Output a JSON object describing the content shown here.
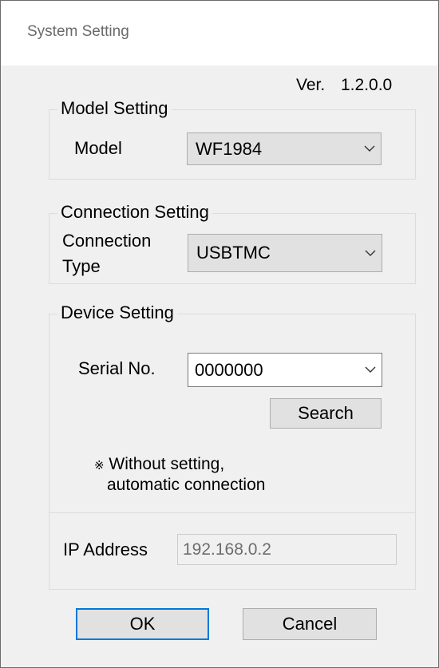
{
  "window": {
    "title": "System Setting"
  },
  "version": {
    "label": "Ver.",
    "value": "1.2.0.0"
  },
  "model_setting": {
    "legend": "Model Setting",
    "model_label": "Model",
    "model_value": "WF1984"
  },
  "connection_setting": {
    "legend": "Connection Setting",
    "type_label_line1": "Connection",
    "type_label_line2": "Type",
    "type_value": "USBTMC"
  },
  "device_setting": {
    "legend": "Device Setting",
    "serial_label": "Serial No.",
    "serial_value": "0000000",
    "search_label": "Search",
    "note_mark": "※",
    "note_line1": "Without setting,",
    "note_line2": "automatic connection",
    "ip_label": "IP Address",
    "ip_value": "192.168.0.2"
  },
  "buttons": {
    "ok_label": "OK",
    "cancel_label": "Cancel"
  },
  "icons": {
    "dropdown": "chevron-down-icon",
    "note": "reference-mark-icon"
  },
  "colors": {
    "default_button_border": "#0078d7",
    "dialog_background": "#f0f0f0",
    "title_text": "#6a6a6a"
  }
}
